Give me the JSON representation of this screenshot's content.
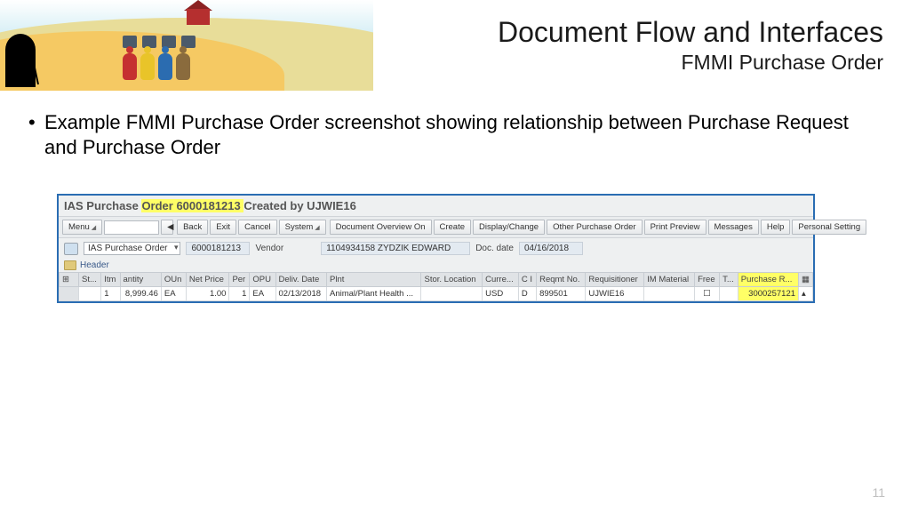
{
  "slide": {
    "title": "Document Flow and Interfaces",
    "subtitle": "FMMI Purchase Order",
    "bullet": "Example FMMI Purchase Order screenshot showing relationship between Purchase Request and Purchase Order",
    "page_num": "11"
  },
  "screenshot": {
    "title_prefix": "IAS Purchase ",
    "title_highlight": "Order 6000181213 ",
    "title_suffix": "Created by UJWIE16",
    "toolbar": {
      "menu": "Menu",
      "back_arrow": "◀",
      "back": "Back",
      "exit": "Exit",
      "cancel": "Cancel",
      "system": "System",
      "doc_overview": "Document Overview On",
      "create": "Create",
      "display_change": "Display/Change",
      "other_po": "Other Purchase Order",
      "print_preview": "Print Preview",
      "messages": "Messages",
      "help": "Help",
      "personal_setting": "Personal Setting"
    },
    "detail": {
      "doc_type": "IAS Purchase Order",
      "doc_number": "6000181213",
      "vendor_label": "Vendor",
      "vendor_value": "1104934158 ZYDZIK EDWARD",
      "doc_date_label": "Doc. date",
      "doc_date_value": "04/16/2018",
      "header_toggle": "Header"
    },
    "grid": {
      "headers": {
        "status": "St...",
        "itm": "Itm",
        "qty": "antity",
        "oun": "OUn",
        "net_price": "Net Price",
        "per": "Per",
        "opu": "OPU",
        "deliv_date": "Deliv. Date",
        "plnt": "Plnt",
        "stor_loc": "Stor. Location",
        "curr": "Curre...",
        "ci": "C I",
        "reqmt": "Reqmt No.",
        "requisitioner": "Requisitioner",
        "im_material": "IM Material",
        "free": "Free",
        "t": "T...",
        "purchase_r": "Purchase R..."
      },
      "row": {
        "itm": "1",
        "qty": "8,999.46",
        "oun": "EA",
        "net_price": "1.00",
        "per": "1",
        "opu": "EA",
        "deliv_date": "02/13/2018",
        "plnt": "Animal/Plant Health ...",
        "curr": "USD",
        "ci": "D",
        "reqmt": "899501",
        "requisitioner": "UJWIE16",
        "purchase_r": "3000257121"
      }
    }
  }
}
